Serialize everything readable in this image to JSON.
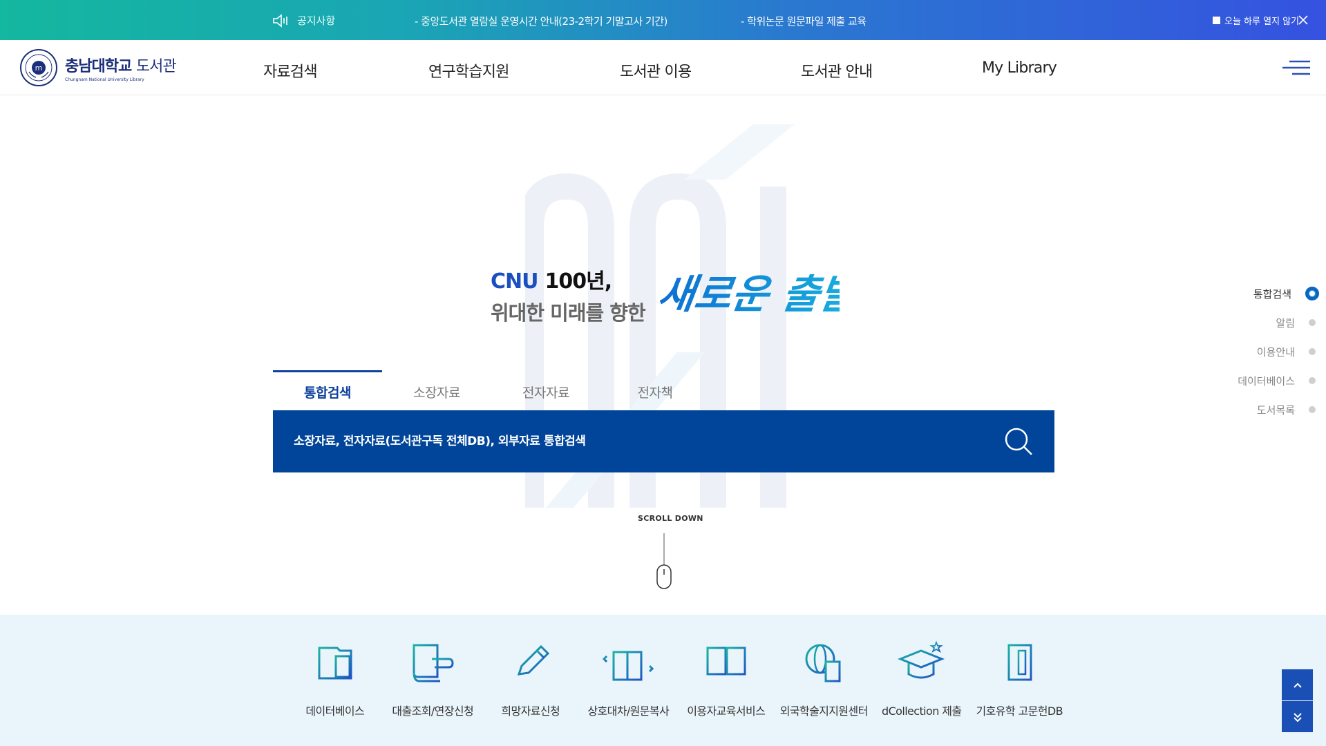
{
  "notice": {
    "label": "공지사항",
    "items": [
      "- 중앙도서관 열람실 운영시간 안내(23-2학기 기말고사 기간)",
      "- 학위논문 원문파일 제출 교육"
    ],
    "close_today": "오늘 하루 열지 않기"
  },
  "header": {
    "logo_ko_bold": "충남대학교",
    "logo_ko": "도서관",
    "logo_en": "Chungnam National University  Library",
    "nav": [
      "자료검색",
      "연구학습지원",
      "도서관 이용",
      "도서관 안내",
      "My Library"
    ]
  },
  "hero": {
    "slogan_cnu": "CNU",
    "slogan_year": "100년,",
    "slogan_line2": "위대한 미래를 향한",
    "slogan_script": "새로운 출발"
  },
  "search": {
    "tabs": [
      "통합검색",
      "소장자료",
      "전자자료",
      "전자책"
    ],
    "active_tab": "통합검색",
    "placeholder": "소장자료, 전자자료(도서관구독 전체DB), 외부자료 통합검색"
  },
  "scroll_label": "SCROLL DOWN",
  "side_nav": [
    "통합검색",
    "알림",
    "이용안내",
    "데이터베이스",
    "도서목록"
  ],
  "quick_menu": [
    {
      "label": "데이터베이스",
      "icon": "database-icon"
    },
    {
      "label": "대출조회/연장신청",
      "icon": "book-hand-icon"
    },
    {
      "label": "희망자료신청",
      "icon": "pencil-icon"
    },
    {
      "label": "상호대차/원문복사",
      "icon": "book-arrows-icon"
    },
    {
      "label": "이용자교육서비스",
      "icon": "open-book-icon"
    },
    {
      "label": "외국학술지지원센터",
      "icon": "globe-document-icon"
    },
    {
      "label": "dCollection 제출",
      "icon": "graduation-cap-icon"
    },
    {
      "label": "기호유학 고문헌DB",
      "icon": "old-book-icon"
    }
  ],
  "colors": {
    "primary": "#004599",
    "accent_teal": "#14b79f",
    "tab_active": "#0d3f9c"
  }
}
